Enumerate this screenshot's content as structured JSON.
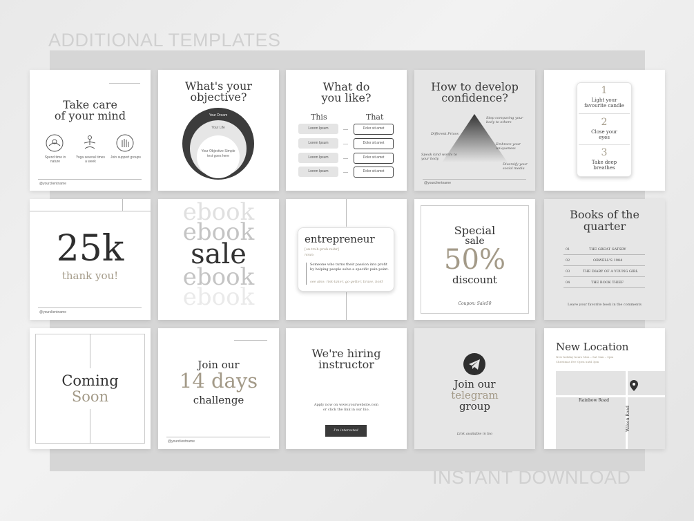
{
  "header": "ADDITIONAL TEMPLATES",
  "footer": "INSTANT DOWNLOAD",
  "c1": {
    "title1": "Take care",
    "title2": "of your mind",
    "items": [
      {
        "icon": "sun-icon",
        "label": "Spend time in nature"
      },
      {
        "icon": "yoga-icon",
        "label": "Yoga several times a week"
      },
      {
        "icon": "hand-icon",
        "label": "Join support groups"
      }
    ],
    "handle": "@yourclientname"
  },
  "c2": {
    "title1": "What's your",
    "title2": "objective?",
    "ring1": "Your Dream",
    "ring2": "Your Life",
    "ring3": "Your Objective Simple text goes here"
  },
  "c3": {
    "title1": "What do",
    "title2": "you like?",
    "col_left": "This",
    "col_right": "That",
    "left_items": [
      "Lorem Ipsum",
      "Lorem Ipsum",
      "Lorem Ipsum",
      "Lorem Ipsum"
    ],
    "right_items": [
      "Dolor sit amet",
      "Dolor sit amet",
      "Dolor sit amet",
      "Dolor sit amet"
    ]
  },
  "c4": {
    "title1": "How to develop",
    "title2": "confidence?",
    "labels": [
      "Stop comparing your body to others",
      "Different Prices",
      "Speak kind words to your body",
      "Embrace your uniqueness",
      "Diversify your social media"
    ],
    "handle": "@yourclientname"
  },
  "c5": {
    "items": [
      {
        "num": "1",
        "text": "Light your favourite candle"
      },
      {
        "num": "2",
        "text": "Close your eyes"
      },
      {
        "num": "3",
        "text": "Take deep breathes"
      }
    ]
  },
  "c6": {
    "big": "25k",
    "sub": "thank you!",
    "handle": "@yourclientname"
  },
  "c7": {
    "word1": "ebook",
    "word2": "ebook",
    "sale": "sale",
    "word3": "ebook",
    "word4": "ebook"
  },
  "c8": {
    "title": "entrepreneur",
    "phonetic": "[on·truh·pruh·nuhr]",
    "pos": "noun:",
    "definition": "Someone who turns their passion into profit by helping people solve a specific pain point.",
    "also": "see also: risk-taker, go-getter, brave, bold"
  },
  "c9": {
    "line1": "Special",
    "line2": "sale",
    "big": "50%",
    "line3": "discount",
    "coupon": "Coupon: Sale50"
  },
  "c10": {
    "title1": "Books of the",
    "title2": "quarter",
    "books": [
      {
        "n": "01",
        "t": "THE GREAT GATSBY"
      },
      {
        "n": "02",
        "t": "ORWELL'S 1984"
      },
      {
        "n": "03",
        "t": "THE DIARY OF A YOUNG GIRL"
      },
      {
        "n": "04",
        "t": "THE BOOK THIEF"
      }
    ],
    "footer": "Leave your favorite book in the comments"
  },
  "c11": {
    "line1": "Coming",
    "line2": "Soon"
  },
  "c12": {
    "line1": "Join our",
    "line2": "14 days",
    "line3": "challenge",
    "handle": "@yourclientname"
  },
  "c13": {
    "title1": "We're hiring",
    "title2": "instructor",
    "body": "Apply now on www.yourwebsite.com or click the link in our bio.",
    "button": "I'm interested"
  },
  "c14": {
    "line1": "Join our",
    "line2": "telegram",
    "line3": "group",
    "link": "Link available in bio",
    "icon": "telegram-icon"
  },
  "c15": {
    "title": "New Location",
    "hours1": "New holiday hours Mon – Sat 9am – 5pm",
    "hours2": "Christmas Eve Open until 3pm",
    "road1": "Rainbow Road",
    "road2": "Wilson Road",
    "icon": "map-pin-icon"
  }
}
